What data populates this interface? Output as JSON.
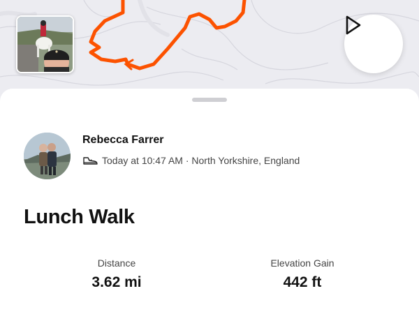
{
  "map": {
    "route_color": "#fc5200",
    "thumbnail": "horse-rider-selfie-photo",
    "play_icon": "play-icon"
  },
  "athlete": {
    "name": "Rebecca Farrer",
    "avatar": "couple-photo",
    "activity_icon": "walking-shoe-icon",
    "meta": "Today at 10:47 AM · North Yorkshire, England"
  },
  "activity": {
    "title": "Lunch Walk",
    "stats": [
      {
        "label": "Distance",
        "value": "3.62 mi"
      },
      {
        "label": "Elevation Gain",
        "value": "442 ft"
      }
    ]
  }
}
